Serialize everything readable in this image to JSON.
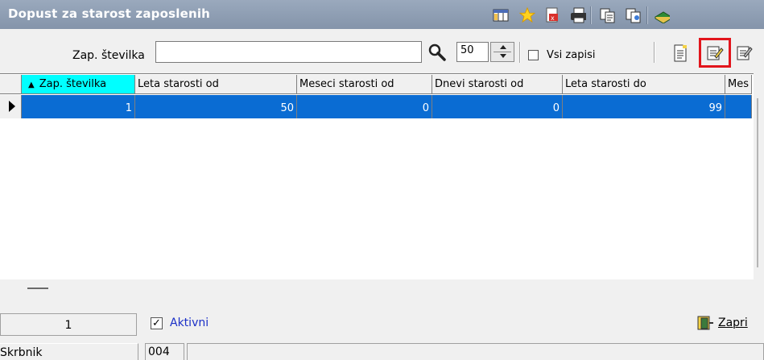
{
  "window": {
    "title": "Dopust za starost zaposlenih"
  },
  "titlebar_icons": [
    "columns-icon",
    "favorite-star-icon",
    "export-pdf-icon",
    "print-icon",
    "copy-record-icon",
    "copy-records-icon",
    "help-book-icon"
  ],
  "toolbar": {
    "search_label": "Zap. številka",
    "search_value": "",
    "page_size": "50",
    "all_records_label": "Vsi zapisi",
    "all_records_checked": false,
    "actions": [
      "new-record-icon",
      "edit-record-icon",
      "multi-edit-icon"
    ]
  },
  "grid": {
    "sort_indicator": "▲",
    "columns": [
      "Zap. številka",
      "Leta starosti od",
      "Meseci starosti od",
      "Dnevi starosti od",
      "Leta starosti do",
      "Mes"
    ],
    "rows": [
      [
        "1",
        "50",
        "0",
        "0",
        "99",
        ""
      ]
    ],
    "selected_color": "#0a6cd3",
    "sorted_header_color": "#00ffff"
  },
  "footer": {
    "record_count": "1",
    "active_label": "Aktivni",
    "active_checked": true,
    "close_label": "Zapri"
  },
  "statusbar": {
    "left": "Skrbnik",
    "middle": "004",
    "right": ""
  },
  "highlight_color": "#e2151c"
}
